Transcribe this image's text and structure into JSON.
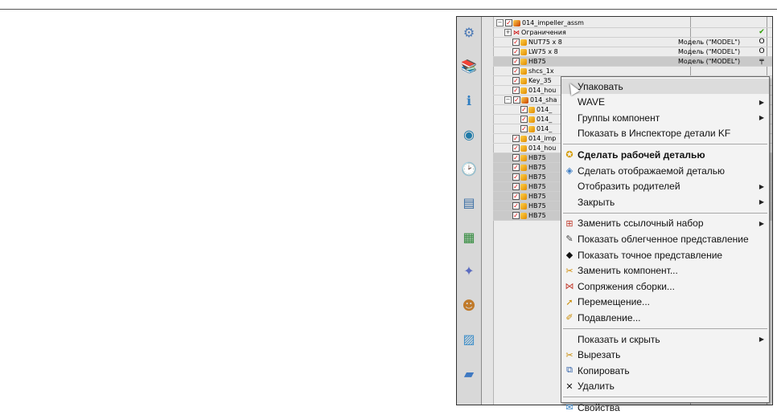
{
  "tree": {
    "rows": [
      {
        "name": "014_impeller_assm",
        "level": 0,
        "expander": "⊟",
        "checked": true,
        "icon": "assembly",
        "ref": "",
        "status": ""
      },
      {
        "name": "Ограничения",
        "level": 1,
        "expander": "⊞",
        "checked": false,
        "icon": "constraints",
        "ref": "",
        "status": "✔"
      },
      {
        "name": "NUT75 x 8",
        "level": 2,
        "expander": "",
        "checked": true,
        "icon": "part",
        "ref": "Модель (\"MODEL\")",
        "status": "O"
      },
      {
        "name": "LW75 x 8",
        "level": 2,
        "expander": "",
        "checked": true,
        "icon": "part",
        "ref": "Модель (\"MODEL\")",
        "status": "O"
      },
      {
        "name": "HB75",
        "level": 2,
        "expander": "",
        "checked": true,
        "icon": "part",
        "ref": "Модель (\"MODEL\")",
        "status": "╤",
        "selected": true
      },
      {
        "name": "shcs_1x",
        "level": 2,
        "expander": "",
        "checked": true,
        "icon": "part",
        "ref": "",
        "status": ""
      },
      {
        "name": "Key_35",
        "level": 2,
        "expander": "",
        "checked": true,
        "icon": "part",
        "ref": "",
        "status": ""
      },
      {
        "name": "014_hou",
        "level": 2,
        "expander": "",
        "checked": true,
        "icon": "part",
        "ref": "",
        "status": ""
      },
      {
        "name": "014_sha",
        "level": 1,
        "expander": "⊟",
        "checked": true,
        "icon": "assembly",
        "ref": "",
        "status": ""
      },
      {
        "name": "014_",
        "level": 3,
        "expander": "",
        "checked": true,
        "icon": "part",
        "ref": "",
        "status": ""
      },
      {
        "name": "014_",
        "level": 3,
        "expander": "",
        "checked": true,
        "icon": "part",
        "ref": "",
        "status": ""
      },
      {
        "name": "014_",
        "level": 3,
        "expander": "",
        "checked": true,
        "icon": "part",
        "ref": "",
        "status": ""
      },
      {
        "name": "014_imp",
        "level": 2,
        "expander": "",
        "checked": true,
        "icon": "part",
        "ref": "",
        "status": ""
      },
      {
        "name": "014_hou",
        "level": 2,
        "expander": "",
        "checked": true,
        "icon": "part",
        "ref": "",
        "status": ""
      },
      {
        "name": "HB75",
        "level": 2,
        "expander": "",
        "checked": true,
        "icon": "part",
        "ref": "",
        "status": "",
        "selected": true
      },
      {
        "name": "HB75",
        "level": 2,
        "expander": "",
        "checked": true,
        "icon": "part",
        "ref": "",
        "status": "",
        "selected": true
      },
      {
        "name": "HB75",
        "level": 2,
        "expander": "",
        "checked": true,
        "icon": "part",
        "ref": "",
        "status": "",
        "selected": true
      },
      {
        "name": "HB75",
        "level": 2,
        "expander": "",
        "checked": true,
        "icon": "part",
        "ref": "",
        "status": "",
        "selected": true
      },
      {
        "name": "HB75",
        "level": 2,
        "expander": "",
        "checked": true,
        "icon": "part",
        "ref": "",
        "status": "",
        "selected": true
      },
      {
        "name": "HB75",
        "level": 2,
        "expander": "",
        "checked": true,
        "icon": "part",
        "ref": "",
        "status": "",
        "selected": true
      },
      {
        "name": "HB75",
        "level": 2,
        "expander": "",
        "checked": true,
        "icon": "part",
        "ref": "",
        "status": "",
        "selected": true
      }
    ]
  },
  "toolbar": {
    "icons": [
      "assembly-navigator-icon",
      "part-navigator-icon",
      "history-icon",
      "info-icon",
      "clock-icon",
      "palette-icon",
      "roles-icon",
      "reuse-library-icon",
      "system-materials-icon",
      "web-browser-icon",
      "folder-icon"
    ]
  },
  "context_menu": {
    "items": [
      {
        "type": "item",
        "label": "Упаковать",
        "icon": "",
        "arrow": false,
        "hover": true
      },
      {
        "type": "item",
        "label": "WAVE",
        "icon": "",
        "arrow": true
      },
      {
        "type": "item",
        "label": "Группы компонент",
        "icon": "",
        "arrow": true
      },
      {
        "type": "item",
        "label": "Показать в Инспекторе детали KF",
        "icon": "",
        "arrow": false
      },
      {
        "type": "sep"
      },
      {
        "type": "item",
        "label": "Сделать рабочей деталью",
        "icon": "work-part-icon",
        "arrow": false,
        "bold": true
      },
      {
        "type": "item",
        "label": "Сделать отображаемой деталью",
        "icon": "displayed-part-icon",
        "arrow": false
      },
      {
        "type": "item",
        "label": "Отобразить родителей",
        "icon": "",
        "arrow": true
      },
      {
        "type": "item",
        "label": "Закрыть",
        "icon": "",
        "arrow": true
      },
      {
        "type": "sep"
      },
      {
        "type": "item",
        "label": "Заменить ссылочный набор",
        "icon": "reference-set-icon",
        "arrow": true
      },
      {
        "type": "item",
        "label": "Показать облегченное представление",
        "icon": "lightweight-icon",
        "arrow": false
      },
      {
        "type": "item",
        "label": "Показать точное представление",
        "icon": "exact-icon",
        "arrow": false
      },
      {
        "type": "item",
        "label": "Заменить компонент...",
        "icon": "replace-component-icon",
        "arrow": false
      },
      {
        "type": "item",
        "label": "Сопряжения сборки...",
        "icon": "assembly-constraints-icon",
        "arrow": false
      },
      {
        "type": "item",
        "label": "Перемещение...",
        "icon": "move-icon",
        "arrow": false
      },
      {
        "type": "item",
        "label": "Подавление...",
        "icon": "suppress-icon",
        "arrow": false
      },
      {
        "type": "sep"
      },
      {
        "type": "item",
        "label": "Показать и скрыть",
        "icon": "",
        "arrow": true
      },
      {
        "type": "item",
        "label": "Вырезать",
        "icon": "cut-icon",
        "arrow": false
      },
      {
        "type": "item",
        "label": "Копировать",
        "icon": "copy-icon",
        "arrow": false
      },
      {
        "type": "item",
        "label": "Удалить",
        "icon": "delete-icon",
        "arrow": false
      },
      {
        "type": "sep"
      },
      {
        "type": "item",
        "label": "Свойства",
        "icon": "properties-icon",
        "arrow": false
      }
    ]
  },
  "colors": {
    "selected_row": "#c9c9c9",
    "menu_bg": "#f3f3f3",
    "menu_hover": "#dcdcdc",
    "check_red": "#d40000",
    "ok_green": "#2a9d00"
  }
}
